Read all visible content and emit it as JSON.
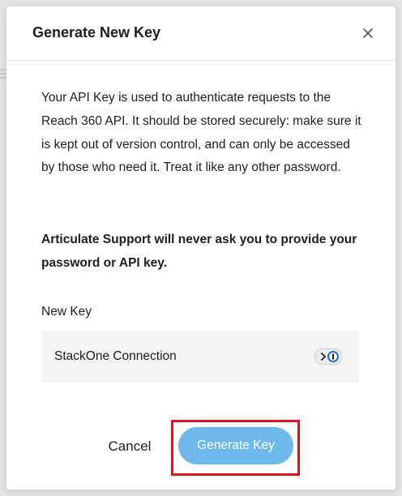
{
  "modal": {
    "title": "Generate New Key",
    "description": "Your API Key is used to authenticate requests to the Reach 360 API. It should be stored securely: make sure it is kept out of version control, and can only be accessed by those who need it. Treat it like any other password.",
    "warning": "Articulate Support will never ask you to provide your password or API key.",
    "field_label": "New Key",
    "key_value": "StackOne Connection",
    "cancel_label": "Cancel",
    "generate_label": "Generate Key"
  },
  "icons": {
    "close": "close-icon",
    "password_manager": "password-manager-icon"
  },
  "colors": {
    "primary_button": "#6eb8ec",
    "highlight_border": "#e0131c",
    "overlay": "#e4e4e4"
  }
}
